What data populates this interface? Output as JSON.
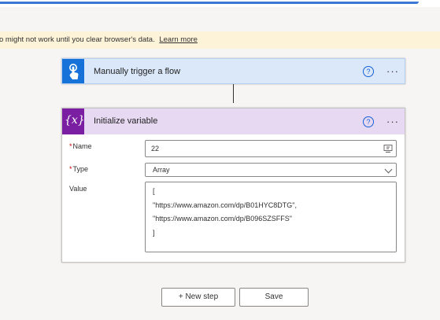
{
  "banner": {
    "message": "o might not work until you clear browser's data.",
    "link_label": "Learn more"
  },
  "trigger_card": {
    "title": "Manually trigger a flow",
    "help": "?",
    "more": "···"
  },
  "variable_card": {
    "title": "Initialize variable",
    "icon_glyph": "{x}",
    "help": "?",
    "more": "···",
    "name": {
      "required_mark": "*",
      "label": "Name",
      "value": "22"
    },
    "type": {
      "required_mark": "*",
      "label": "Type",
      "selected": "Array"
    },
    "value": {
      "label": "Value",
      "lines": [
        "[",
        "\"https://www.amazon.com/dp/B01HYC8DTG\",",
        "\"https://www.amazon.com/dp/B096SZSFFS\"",
        "]"
      ]
    }
  },
  "actions": {
    "new_step_label": "+ New step",
    "save_label": "Save"
  },
  "colors": {
    "trigger_accent": "#1672d8",
    "variable_accent": "#7b1fa2",
    "banner_bg": "#fcf3d9"
  }
}
